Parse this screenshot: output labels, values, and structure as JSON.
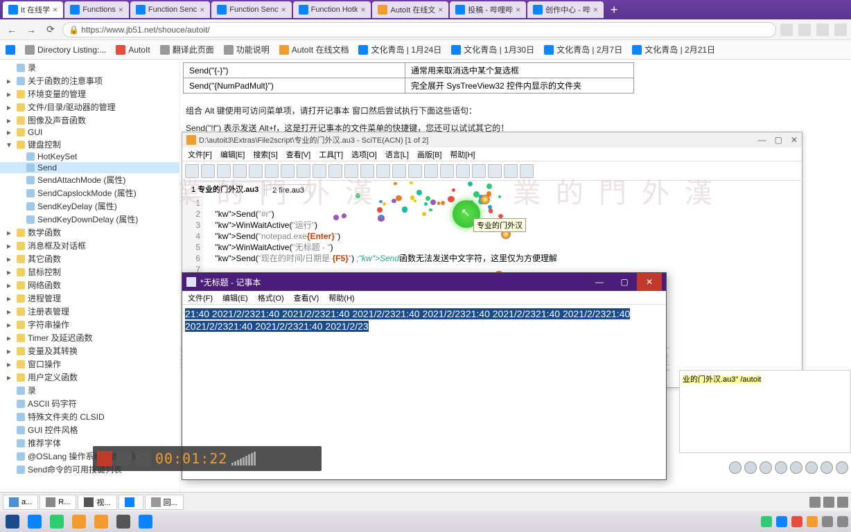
{
  "browser": {
    "tabs": [
      {
        "label": "It 在线学",
        "icon": "b"
      },
      {
        "label": "Functions",
        "icon": "b"
      },
      {
        "label": "Function Senc",
        "icon": "b"
      },
      {
        "label": "Function Senc",
        "icon": "b"
      },
      {
        "label": "Function Hotk",
        "icon": "b"
      },
      {
        "label": "AutoIt 在线文",
        "icon": "o"
      },
      {
        "label": "投稿 - 哔哩哔",
        "icon": "b"
      },
      {
        "label": "创作中心 - 哔",
        "icon": "b"
      }
    ],
    "url": "https://www.jb51.net/shouce/autoit/",
    "bookmarks": [
      {
        "label": "Directory Listing:...",
        "ico": "g"
      },
      {
        "label": "AutoIt",
        "ico": "r"
      },
      {
        "label": "翻译此页面",
        "ico": "g"
      },
      {
        "label": "功能说明",
        "ico": "g"
      },
      {
        "label": "AutoIt 在线文档",
        "ico": "o"
      },
      {
        "label": "文化青岛 | 1月24日",
        "ico": "b"
      },
      {
        "label": "文化青岛 | 1月30日",
        "ico": "b"
      },
      {
        "label": "文化青岛 | 2月7日",
        "ico": "b"
      },
      {
        "label": "文化青岛 | 2月21日",
        "ico": "b"
      }
    ]
  },
  "sidebar": {
    "items": [
      {
        "t": "录",
        "exp": ""
      },
      {
        "t": "关于函数的注意事项",
        "exp": "▸",
        "i": "f"
      },
      {
        "t": "环境变量的管理",
        "exp": "▸",
        "i": "d"
      },
      {
        "t": "文件/目录/驱动器的管理",
        "exp": "▸",
        "i": "d"
      },
      {
        "t": "图像及声音函数",
        "exp": "▸",
        "i": "d"
      },
      {
        "t": "GUI",
        "exp": "▸",
        "i": "d"
      },
      {
        "t": "键盘控制",
        "exp": "▾",
        "i": "d"
      },
      {
        "t": "HotKeySet",
        "exp": "",
        "i": "f",
        "ind": 1
      },
      {
        "t": "Send",
        "exp": "",
        "i": "f",
        "ind": 1,
        "sel": true
      },
      {
        "t": "SendAttachMode (属性)",
        "exp": "",
        "i": "f",
        "ind": 1
      },
      {
        "t": "SendCapslockMode (属性)",
        "exp": "",
        "i": "f",
        "ind": 1
      },
      {
        "t": "SendKeyDelay (属性)",
        "exp": "",
        "i": "f",
        "ind": 1
      },
      {
        "t": "SendKeyDownDelay (属性)",
        "exp": "",
        "i": "f",
        "ind": 1
      },
      {
        "t": "数学函数",
        "exp": "▸",
        "i": "d"
      },
      {
        "t": "消息框及对话框",
        "exp": "▸",
        "i": "d"
      },
      {
        "t": "其它函数",
        "exp": "▸",
        "i": "d"
      },
      {
        "t": "鼠标控制",
        "exp": "▸",
        "i": "d"
      },
      {
        "t": "网络函数",
        "exp": "▸",
        "i": "d"
      },
      {
        "t": "进程管理",
        "exp": "▸",
        "i": "d"
      },
      {
        "t": "注册表管理",
        "exp": "▸",
        "i": "d"
      },
      {
        "t": "字符串操作",
        "exp": "▸",
        "i": "d"
      },
      {
        "t": "Timer 及延迟函数",
        "exp": "▸",
        "i": "d"
      },
      {
        "t": "变量及其转换",
        "exp": "▸",
        "i": "d"
      },
      {
        "t": "窗口操作",
        "exp": "▸",
        "i": "d"
      },
      {
        "t": "用户定义函数",
        "exp": "▸",
        "i": "d"
      },
      {
        "t": "录",
        "exp": ""
      },
      {
        "t": "ASCII 码字符",
        "exp": "",
        "i": "f"
      },
      {
        "t": "特殊文件夹的 CLSID",
        "exp": "",
        "i": "f"
      },
      {
        "t": "GUI 控件风格",
        "exp": "",
        "i": "f"
      },
      {
        "t": "推荐字体",
        "exp": "",
        "i": "f"
      },
      {
        "t": "@OSLang 操作系统语言代码",
        "exp": "",
        "i": "f"
      },
      {
        "t": "Send命令的可用按键列表",
        "exp": "",
        "i": "f"
      }
    ]
  },
  "page": {
    "table": [
      {
        "c1": "Send(\"{-}\")",
        "c2": "通常用来取消选中某个复选框"
      },
      {
        "c1": "Send(\"{NumPadMult}\")",
        "c2": "完全展开 SysTreeView32 控件内显示的文件夹"
      }
    ],
    "text1": "组合 Alt 键使用可访问菜单项，请打开记事本 窗口然后尝试执行下面这些语句：",
    "text2": "Send(\"!f\") 表示发送 Alt+f，这是打开记事本的文件菜单的快捷键，您还可以试试其它的！"
  },
  "scite": {
    "title": "D:\\autoit3\\Extras\\File2script\\专业的门外汉.au3 - SciTE(ACN) [1 of 2]",
    "menus": [
      "文件[F]",
      "编辑[E]",
      "搜索[S]",
      "查看[V]",
      "工具[T]",
      "选项[O]",
      "语言[L]",
      "画版[B]",
      "帮助[H]"
    ],
    "tabs": [
      "1 专业的门外汉.au3",
      "2 fire.au3"
    ],
    "tooltip": "专业的门外汉",
    "lines": [
      {
        "n": "1",
        "c": ""
      },
      {
        "n": "2",
        "c": "Send(\"#r\")"
      },
      {
        "n": "3",
        "c": "WinWaitActive(\"运行\")"
      },
      {
        "n": "4",
        "c": "Send(\"notepad.exe{Enter}\")"
      },
      {
        "n": "5",
        "c": "WinWaitActive(\"无标题 - \")"
      },
      {
        "n": "6",
        "c": "Send(\"现在的时间/日期是 {F5}\")   ;Send函数无法发送中文字符，这里仅为方便理解"
      },
      {
        "n": "7",
        "c": ""
      }
    ]
  },
  "notepad": {
    "title": "*无标题 - 记事本",
    "menus": [
      "文件(F)",
      "编辑(E)",
      "格式(O)",
      "查看(V)",
      "帮助(H)"
    ],
    "content": "21:40 2021/2/2321:40 2021/2/2321:40 2021/2/2321:40 2021/2/2321:40 2021/2/2321:40 2021/2/2321:40 2021/2/2321:40 2021/2/2321:40 2021/2/23"
  },
  "recorder": {
    "time": "00:01:22"
  },
  "output": {
    "line": "业的门外汉.au3\" /autoit"
  },
  "watermark": "業 的 門 外 漢",
  "taskbar1": {
    "items": [
      {
        "l": "a...",
        "c": "#4a90d9"
      },
      {
        "l": "R...",
        "c": "#888"
      },
      {
        "l": "视...",
        "c": "#555"
      },
      {
        "l": "",
        "c": "#0a84ff"
      },
      {
        "l": "回...",
        "c": "#999"
      }
    ]
  }
}
